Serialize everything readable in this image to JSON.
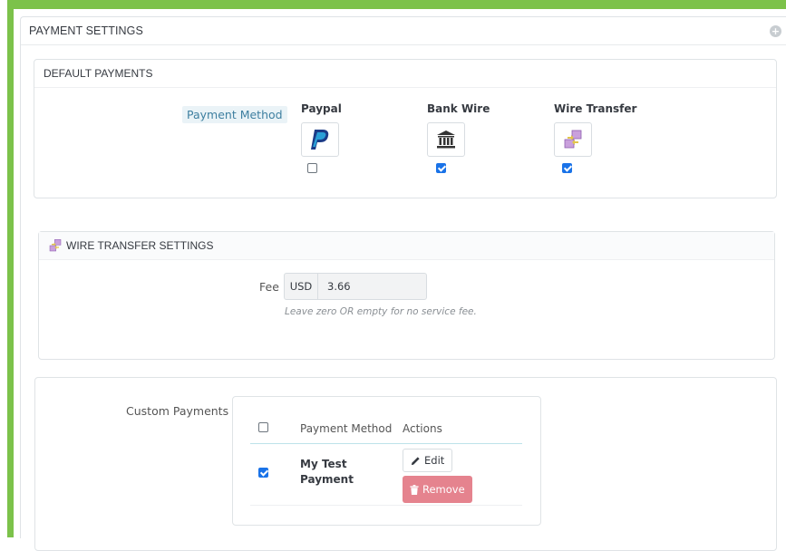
{
  "panel": {
    "title": "PAYMENT SETTINGS"
  },
  "default_payments": {
    "title": "DEFAULT PAYMENTS",
    "label": "Payment Method",
    "methods": [
      {
        "name": "Paypal",
        "icon": "paypal-icon",
        "checked": false
      },
      {
        "name": "Bank Wire",
        "icon": "bank-icon",
        "checked": true
      },
      {
        "name": "Wire Transfer",
        "icon": "wire-transfer-icon",
        "checked": true
      }
    ]
  },
  "wire_transfer": {
    "title": "WIRE TRANSFER SETTINGS",
    "fee_label": "Fee",
    "currency": "USD",
    "fee_value": "3.66",
    "help": "Leave zero OR empty for no service fee."
  },
  "custom_payments": {
    "label": "Custom Payments",
    "headers": {
      "method": "Payment Method",
      "actions": "Actions"
    },
    "rows": [
      {
        "name": "My Test Payment",
        "checked": true,
        "edit": "Edit",
        "remove": "Remove"
      }
    ]
  },
  "colors": {
    "accent_green": "#7cc24a",
    "checkbox_blue": "#1a73e8",
    "remove_red": "#e5838e"
  }
}
